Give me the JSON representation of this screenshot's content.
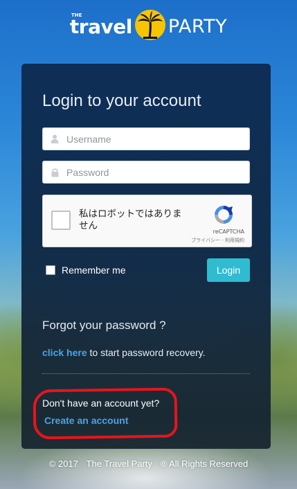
{
  "logo": {
    "small_text": "THE",
    "word1": "travel",
    "word2": "PARTY"
  },
  "login": {
    "title": "Login to your account",
    "username_placeholder": "Username",
    "password_placeholder": "Password",
    "remember_label": "Remember me",
    "login_button": "Login"
  },
  "recaptcha": {
    "label": "私はロボットではありません",
    "brand": "reCAPTCHA",
    "links": "プライバシー - 利用規約"
  },
  "forgot": {
    "title": "Forgot your password ?",
    "link_text": "click here",
    "rest_text": " to start password recovery."
  },
  "signup": {
    "prompt": "Don't have an account yet?",
    "link_text": "Create an account"
  },
  "footer": {
    "year": "© 2017",
    "company": "The Travel Party",
    "rights": "® All Rights Reserved"
  },
  "colors": {
    "accent": "#2fbcd1",
    "link": "#4aa3e6",
    "annotation": "#e8141b"
  },
  "icons": [
    "user-icon",
    "lock-icon",
    "palm-tree-icon",
    "recaptcha-icon"
  ]
}
